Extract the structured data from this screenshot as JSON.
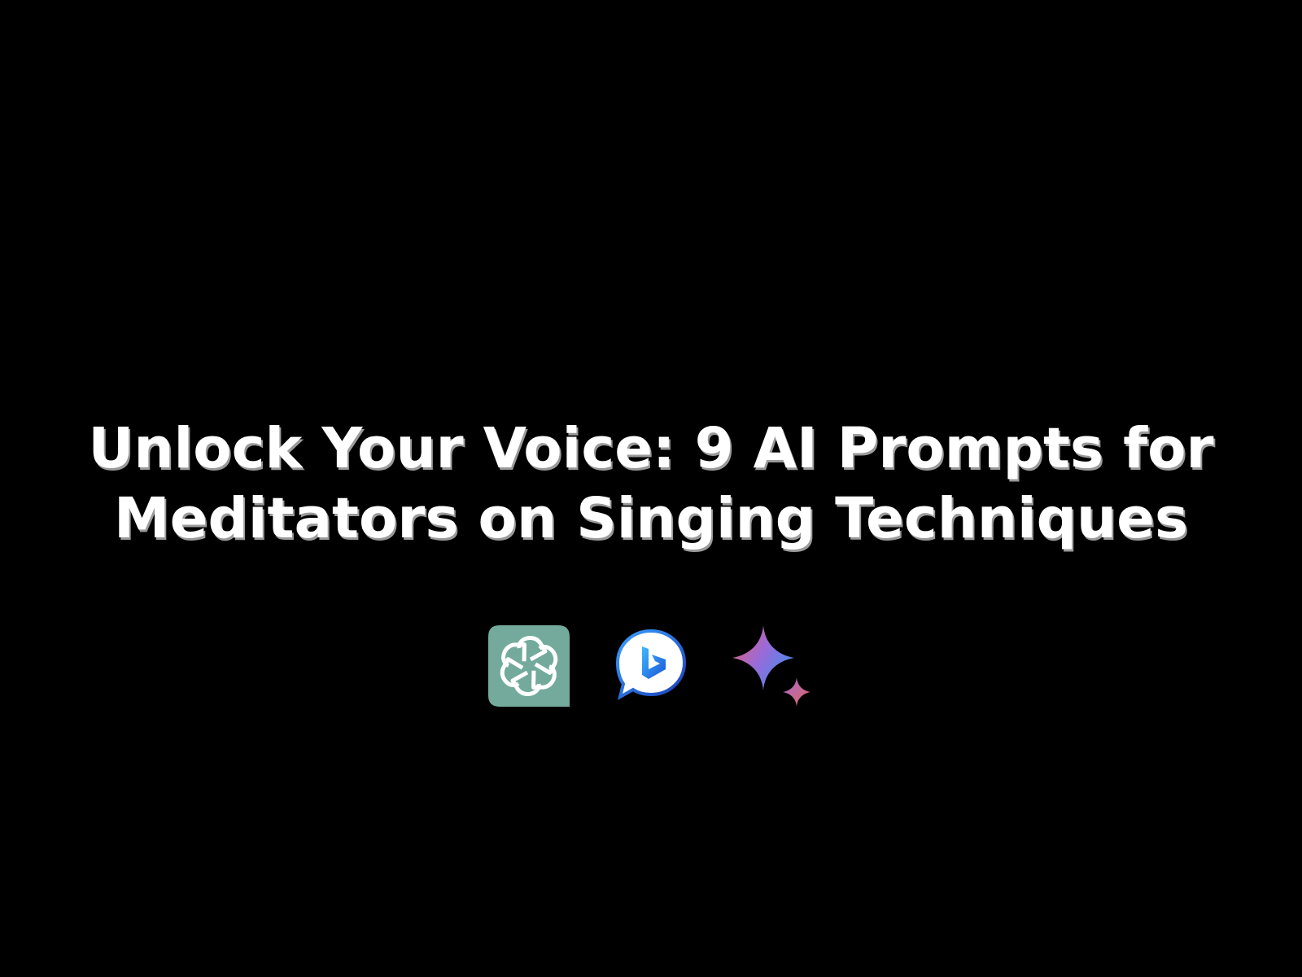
{
  "title": {
    "line1": "Unlock Your Voice: 9 AI Prompts for",
    "line2": "Meditators on Singing Techniques"
  },
  "logos": [
    {
      "icon": "chatgpt-logo-icon",
      "color": "#74aa9c"
    },
    {
      "icon": "bing-logo-icon",
      "color": "#1b6fd8"
    },
    {
      "icon": "gemini-sparkle-logo-icon",
      "color": "#7a8cf0"
    }
  ],
  "colors": {
    "background": "#000000",
    "title_text": "#ffffff",
    "title_shadow": "#9a9a9a"
  }
}
